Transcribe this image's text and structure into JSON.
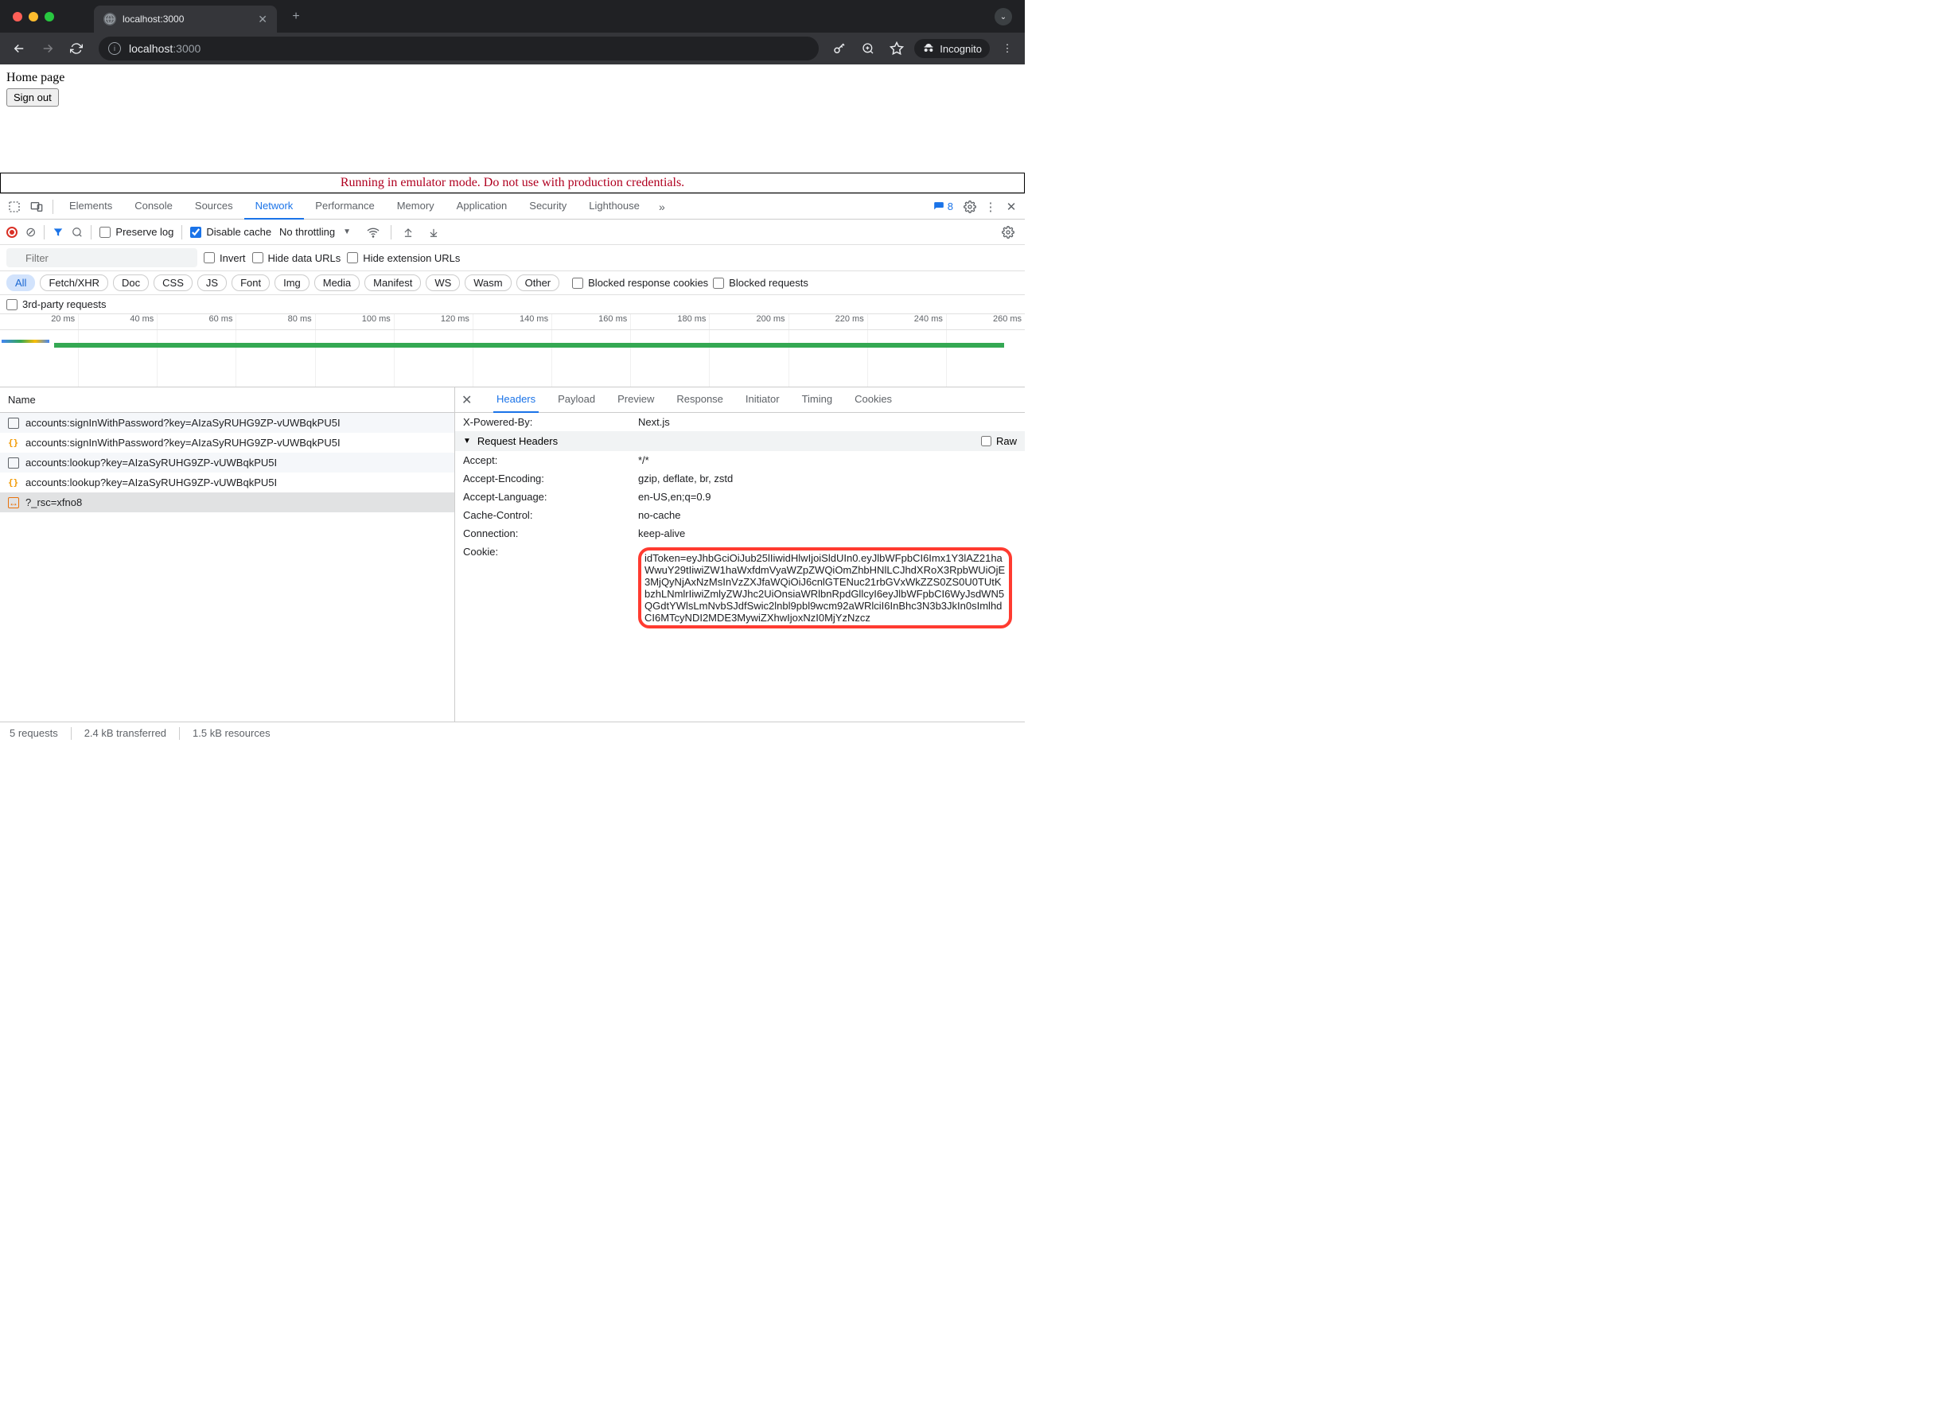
{
  "browser": {
    "tab_title": "localhost:3000",
    "new_tab": "+",
    "url_host": "localhost",
    "url_port": ":3000",
    "incognito_label": "Incognito"
  },
  "page": {
    "heading": "Home page",
    "signout": "Sign out"
  },
  "emulator_banner": "Running in emulator mode. Do not use with production credentials.",
  "devtools": {
    "panels": [
      "Elements",
      "Console",
      "Sources",
      "Network",
      "Performance",
      "Memory",
      "Application",
      "Security",
      "Lighthouse"
    ],
    "msg_count": "8",
    "preserve_log": "Preserve log",
    "disable_cache": "Disable cache",
    "throttle": "No throttling",
    "filter_placeholder": "Filter",
    "invert": "Invert",
    "hide_data_urls": "Hide data URLs",
    "hide_ext_urls": "Hide extension URLs",
    "types": [
      "All",
      "Fetch/XHR",
      "Doc",
      "CSS",
      "JS",
      "Font",
      "Img",
      "Media",
      "Manifest",
      "WS",
      "Wasm",
      "Other"
    ],
    "blocked_resp": "Blocked response cookies",
    "blocked_req": "Blocked requests",
    "third_party": "3rd-party requests",
    "ruler": [
      "20 ms",
      "40 ms",
      "60 ms",
      "80 ms",
      "100 ms",
      "120 ms",
      "140 ms",
      "160 ms",
      "180 ms",
      "200 ms",
      "220 ms",
      "240 ms",
      "260 ms"
    ],
    "name_col": "Name",
    "requests": [
      {
        "name": "accounts:signInWithPassword?key=AIzaSyRUHG9ZP-vUWBqkPU5I",
        "icon": "doc"
      },
      {
        "name": "accounts:signInWithPassword?key=AIzaSyRUHG9ZP-vUWBqkPU5I",
        "icon": "json"
      },
      {
        "name": "accounts:lookup?key=AIzaSyRUHG9ZP-vUWBqkPU5I",
        "icon": "doc"
      },
      {
        "name": "accounts:lookup?key=AIzaSyRUHG9ZP-vUWBqkPU5I",
        "icon": "json"
      },
      {
        "name": "?_rsc=xfno8",
        "icon": "fetch"
      }
    ],
    "detail_tabs": [
      "Headers",
      "Payload",
      "Preview",
      "Response",
      "Initiator",
      "Timing",
      "Cookies"
    ],
    "xpowered_key": "X-Powered-By:",
    "xpowered_val": "Next.js",
    "req_headers_title": "Request Headers",
    "raw_label": "Raw",
    "headers": [
      {
        "k": "Accept:",
        "v": "*/*"
      },
      {
        "k": "Accept-Encoding:",
        "v": "gzip, deflate, br, zstd"
      },
      {
        "k": "Accept-Language:",
        "v": "en-US,en;q=0.9"
      },
      {
        "k": "Cache-Control:",
        "v": "no-cache"
      },
      {
        "k": "Connection:",
        "v": "keep-alive"
      }
    ],
    "cookie_key": "Cookie:",
    "cookie_val": "idToken=eyJhbGciOiJub25lIiwidHlwIjoiSldUIn0.eyJlbWFpbCI6Imx1Y3lAZ21haWwuY29tIiwiZW1haWxfdmVyaWZpZWQiOmZhbHNlLCJhdXRoX3RpbWUiOjE3MjQyNjAxNzMsInVzZXJfaWQiOiJ6cnlGTENuc21rbGVxWkZZS0ZS0U0TUtKbzhLNmlrIiwiZmlyZWJhc2UiOnsiaWRlbnRpdGllcyI6eyJlbWFpbCI6WyJsdWN5QGdtYWlsLmNvbSJdfSwic2lnbl9pbl9wcm92aWRlciI6InBhc3N3b3JkIn0sImlhdCI6MTcyNDI2MDE3MywiZXhwIjoxNzI0MjYzNzcz",
    "status": {
      "requests": "5 requests",
      "transferred": "2.4 kB transferred",
      "resources": "1.5 kB resources"
    }
  }
}
